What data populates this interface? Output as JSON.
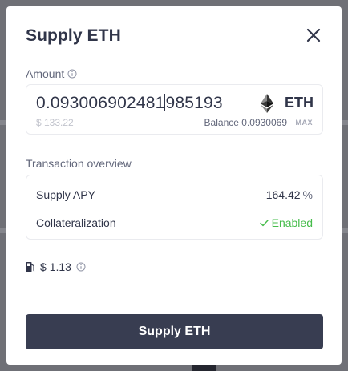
{
  "modal": {
    "title": "Supply ETH",
    "close_label": "close"
  },
  "amount": {
    "label": "Amount",
    "value_before_caret": "0.093006902481",
    "value_after_caret": "985193",
    "asset": "ETH",
    "usd_value": "$ 133.22",
    "balance_label": "Balance",
    "balance_value": "0.0930069",
    "max_label": "MAX"
  },
  "overview": {
    "label": "Transaction overview",
    "supply_apy_label": "Supply APY",
    "supply_apy_value": "164.42",
    "supply_apy_unit": "%",
    "collateral_label": "Collateralization",
    "collateral_value": "Enabled"
  },
  "gas": {
    "value": "1.13",
    "currency": "$"
  },
  "submit": {
    "label": "Supply ETH"
  },
  "colors": {
    "primary_button": "#383d51",
    "success": "#46bc4b",
    "text_primary": "#303549",
    "text_secondary": "#62677b"
  },
  "icons": [
    "close-icon",
    "info-icon",
    "eth-icon",
    "check-icon",
    "gas-pump-icon"
  ]
}
